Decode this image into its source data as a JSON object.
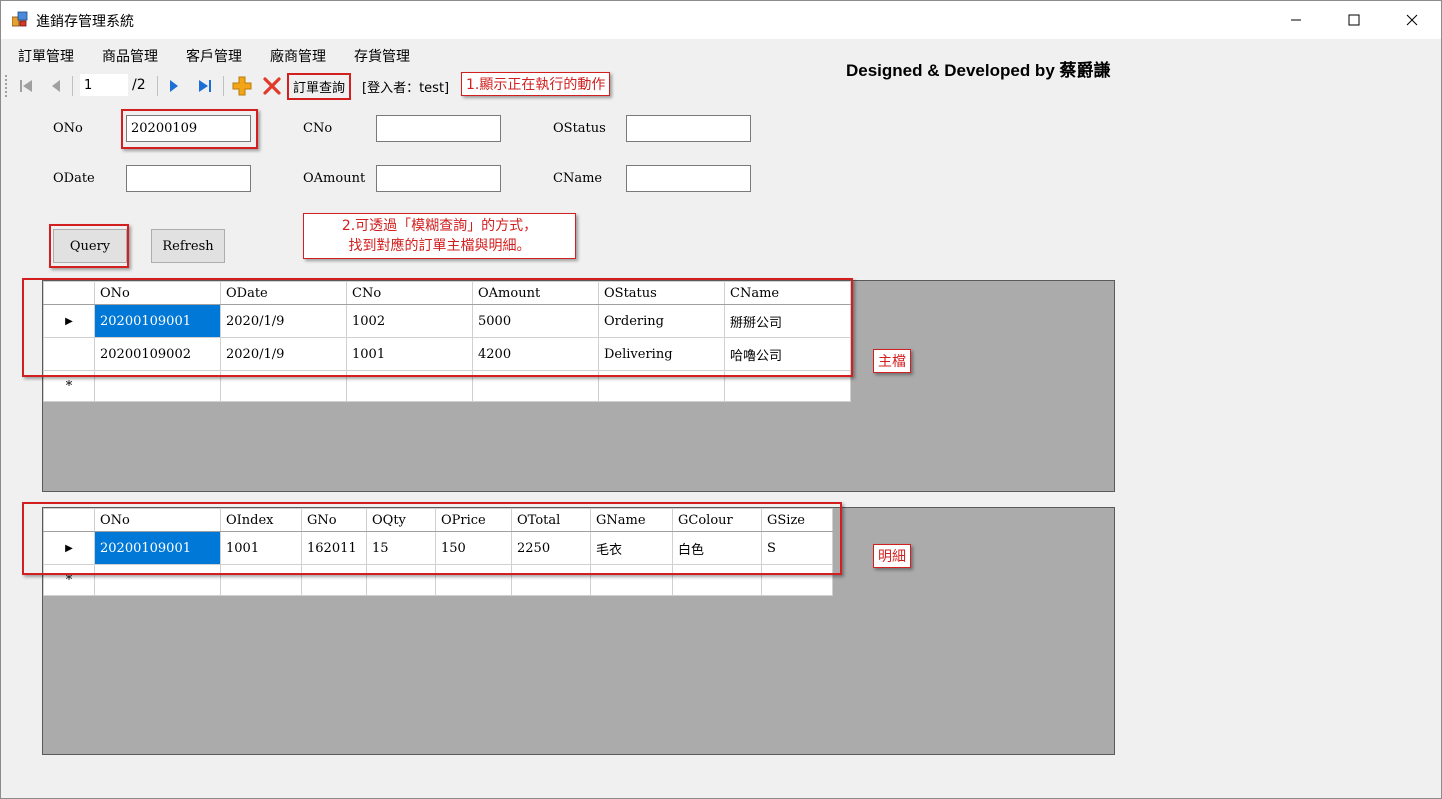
{
  "window": {
    "title": "進銷存管理系統",
    "minimize_glyph": "—",
    "maximize_glyph": "☐",
    "close_glyph": "✕"
  },
  "menu": {
    "items": [
      "訂單管理",
      "商品管理",
      "客戶管理",
      "廠商管理",
      "存貨管理"
    ]
  },
  "credit": "Designed & Developed by 蔡爵謙",
  "navigator": {
    "position": "1",
    "count_label": "/2",
    "current_action": "訂單查詢",
    "login_label": "[登入者：test]"
  },
  "annotations": {
    "note1": "1.顯示正在執行的動作",
    "note2_line1": "2.可透過「模糊查詢」的方式，",
    "note2_line2": "找到對應的訂單主檔與明細。",
    "master_label": "主檔",
    "detail_label": "明細"
  },
  "form": {
    "ono_label": "ONo",
    "ono_value": "20200109",
    "cno_label": "CNo",
    "cno_value": "",
    "ostatus_label": "OStatus",
    "ostatus_value": "",
    "odate_label": "ODate",
    "odate_value": "",
    "oamount_label": "OAmount",
    "oamount_value": "",
    "cname_label": "CName",
    "cname_value": "",
    "query_label": "Query",
    "refresh_label": "Refresh"
  },
  "master_grid": {
    "columns": [
      "ONo",
      "ODate",
      "CNo",
      "OAmount",
      "OStatus",
      "CName"
    ],
    "rows": [
      [
        "20200109001",
        "2020/1/9",
        "1002",
        "5000",
        "Ordering",
        "掰掰公司"
      ],
      [
        "20200109002",
        "2020/1/9",
        "1001",
        "4200",
        "Delivering",
        "哈嚕公司"
      ]
    ],
    "current_row_glyph": "▶",
    "new_row_glyph": "*"
  },
  "detail_grid": {
    "columns": [
      "ONo",
      "OIndex",
      "GNo",
      "OQty",
      "OPrice",
      "OTotal",
      "GName",
      "GColour",
      "GSize"
    ],
    "rows": [
      [
        "20200109001",
        "1001",
        "162011",
        "15",
        "150",
        "2250",
        "毛衣",
        "白色",
        "S"
      ]
    ],
    "current_row_glyph": "▶",
    "new_row_glyph": "*"
  },
  "colors": {
    "annotation_red": "#d21f1f",
    "selection_blue": "#0078d7",
    "grid_background": "#ababab",
    "nav_blue": "#1c6fd6",
    "add_orange": "#f2a516",
    "delete_red": "#e23a2a"
  },
  "icons": {
    "app": "app-icon",
    "nav": [
      "move-first-icon",
      "move-previous-icon",
      "move-next-icon",
      "move-last-icon"
    ],
    "add": "add-icon",
    "delete": "delete-icon"
  }
}
